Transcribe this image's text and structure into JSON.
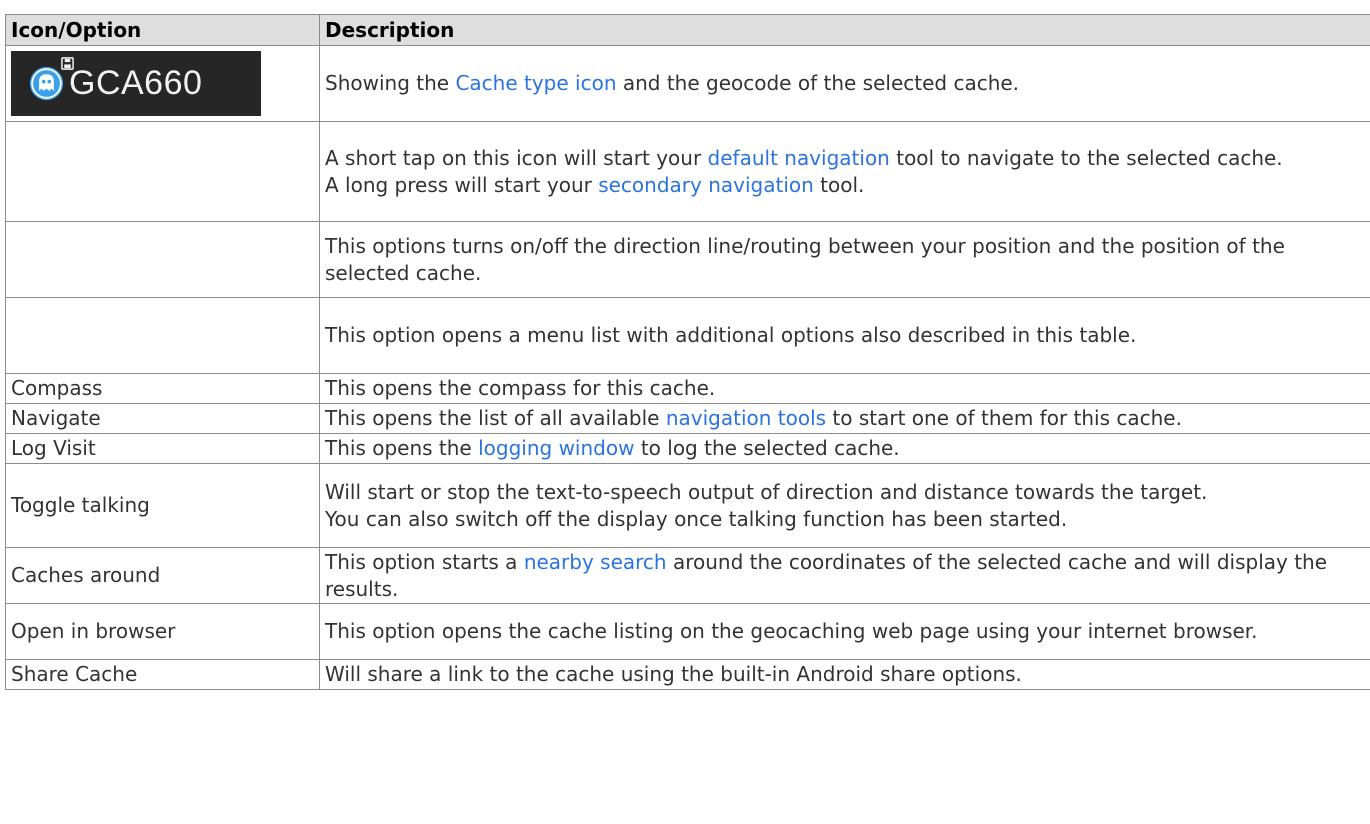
{
  "table": {
    "headers": {
      "icon_option": "Icon/Option",
      "description": "Description"
    },
    "badge": {
      "geocode": "GCA660",
      "icon": "ghost-cache-type-icon",
      "background": "#262626",
      "icon_color": "#3aa0e8"
    },
    "rows": {
      "r0": {
        "d_a": "Showing the ",
        "d_link": "Cache type icon",
        "d_b": " and the geocode of the selected cache."
      },
      "r1": {
        "d1_a": "A short tap on this icon will start your ",
        "d1_link": "default navigation",
        "d1_b": " tool to navigate to the selected cache.",
        "d2_a": "A long press will start your ",
        "d2_link": "secondary navigation",
        "d2_b": " tool."
      },
      "r2": {
        "d": "This options turns on/off the direction line/routing between your position and the position of the selected cache."
      },
      "r3": {
        "d": "This option opens a menu list with additional options also described in this table."
      },
      "r4": {
        "o": "Compass",
        "d": "This opens the compass for this cache."
      },
      "r5": {
        "o": "Navigate",
        "d_a": "This opens the list of all available ",
        "d_link": "navigation tools",
        "d_b": " to start one of them for this cache."
      },
      "r6": {
        "o": "Log Visit",
        "d_a": "This opens the ",
        "d_link": "logging window",
        "d_b": " to log the selected cache."
      },
      "r7": {
        "o": "Toggle talking",
        "d1": "Will start or stop the text-to-speech output of direction and distance towards the target.",
        "d2": "You can also switch off the display once talking function has been started."
      },
      "r8": {
        "o": "Caches around",
        "d_a": "This option starts a ",
        "d_link": "nearby search",
        "d_b": " around the coordinates of the selected cache and will display the results."
      },
      "r9": {
        "o": "Open in browser",
        "d": "This option opens the cache listing on the geocaching web page using your internet browser."
      },
      "r10": {
        "o": "Share Cache",
        "d": "Will share a link to the cache using the built-in Android share options."
      }
    }
  },
  "colors": {
    "link": "#2b73e0",
    "header_bg": "#dedede",
    "border": "#8b8b8b",
    "text": "#333333"
  }
}
